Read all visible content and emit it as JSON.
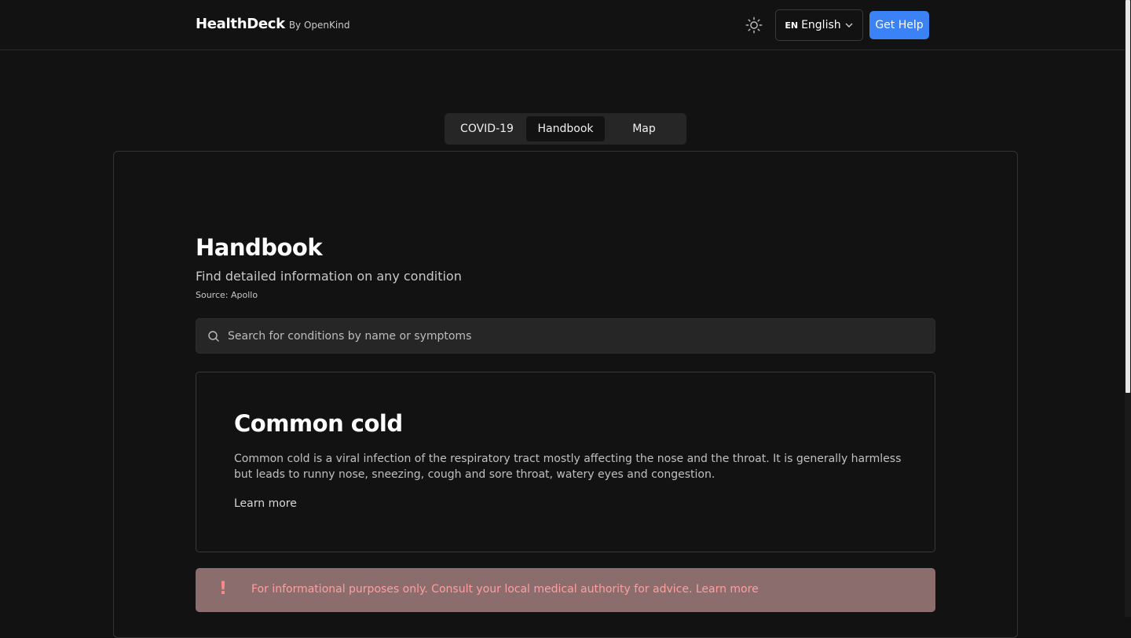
{
  "header": {
    "brand_name": "HealthDeck",
    "brand_by": "By OpenKind",
    "language_code": "EN",
    "language_label": "English",
    "help_label": "Get Help",
    "theme_icon": "sun-icon"
  },
  "tabs": [
    {
      "label": "COVID-19",
      "active": false
    },
    {
      "label": "Handbook",
      "active": true
    },
    {
      "label": "Map",
      "active": false
    }
  ],
  "handbook": {
    "title": "Handbook",
    "subtitle": "Find detailed information on any condition",
    "source": "Source: Apollo",
    "search_placeholder": "Search for conditions by name or symptoms"
  },
  "condition": {
    "title": "Common cold",
    "description": "Common cold is a viral infection of the respiratory tract mostly affecting the nose and the throat. It is generally harmless but leads to runny nose, sneezing, cough and sore throat, watery eyes and congestion.",
    "learn_more": "Learn more"
  },
  "alert": {
    "icon": "!",
    "text": "For informational purposes only. Consult your local medical authority for advice. Learn more"
  },
  "colors": {
    "background": "#121212",
    "accent": "#3b82f6",
    "alert_bg": "#8b6d6e",
    "alert_text": "#ff9f9f"
  }
}
